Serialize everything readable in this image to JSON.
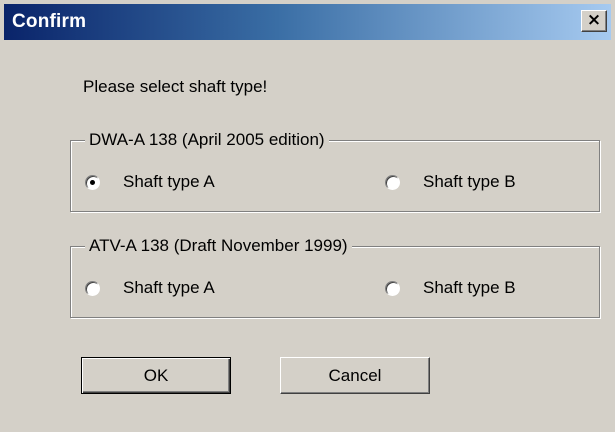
{
  "window": {
    "title": "Confirm",
    "close_glyph": "×"
  },
  "prompt": "Please select shaft type!",
  "groups": [
    {
      "label": "DWA-A 138 (April 2005 edition)",
      "options": [
        {
          "label": "Shaft type A",
          "checked": true
        },
        {
          "label": "Shaft type B",
          "checked": false
        }
      ]
    },
    {
      "label": "ATV-A 138 (Draft November 1999)",
      "options": [
        {
          "label": "Shaft type A",
          "checked": false
        },
        {
          "label": "Shaft type B",
          "checked": false
        }
      ]
    }
  ],
  "buttons": {
    "ok_label": "OK",
    "cancel_label": "Cancel"
  },
  "colors": {
    "titlebar_start": "#0a246a",
    "titlebar_end": "#a6caf0",
    "face": "#d4d0c8"
  }
}
